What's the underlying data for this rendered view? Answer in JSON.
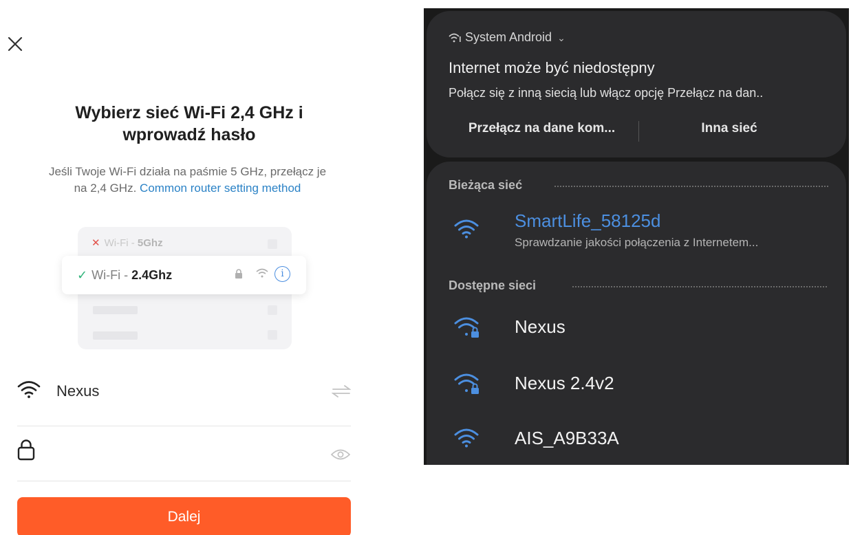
{
  "left": {
    "title_line1": "Wybierz sieć Wi-Fi 2,4 GHz i",
    "title_line2": "wprowadź hasło",
    "subtitle_line1": "Jeśli Twoje Wi-Fi działa na paśmie 5 GHz, przełącz je",
    "subtitle_line2_prefix": "na 2,4 GHz.",
    "subtitle_link": "Common router setting method",
    "illustration": {
      "row1_prefix": "Wi-Fi - ",
      "row1_band": "5Ghz",
      "row2_prefix": "Wi-Fi - ",
      "row2_band": "2.4Ghz"
    },
    "wifi_field_value": "Nexus",
    "password_value": "",
    "next_button": "Dalej"
  },
  "right": {
    "notification": {
      "source": "System Android",
      "headline": "Internet może być niedostępny",
      "message": "Połącz się z inną siecią lub włącz opcję Przełącz na dan..",
      "action_mobile_data": "Przełącz na dane kom...",
      "action_other_network": "Inna sieć"
    },
    "current_section": "Bieżąca sieć",
    "current_network": {
      "name": "SmartLife_58125d",
      "status": "Sprawdzanie jakości połączenia z Internetem..."
    },
    "available_section": "Dostępne sieci",
    "available_networks": [
      {
        "name": "Nexus",
        "icon": "wifi-locked-icon"
      },
      {
        "name": "Nexus 2.4v2",
        "icon": "wifi-locked-icon"
      },
      {
        "name": "AIS_A9B33A",
        "icon": "wifi-icon"
      }
    ]
  },
  "colors": {
    "accent_orange": "#ff5c28",
    "link_blue": "#2b82c6",
    "android_blue": "#4c8fe0",
    "dark_bg": "#1a1a1a",
    "panel_bg": "#2b2b2d"
  }
}
